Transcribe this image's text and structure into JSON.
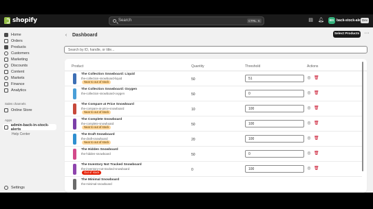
{
  "topbar": {
    "brand": "shopify",
    "search_placeholder": "Search",
    "shortcut_key_1": "CTRL",
    "shortcut_key_2": "K",
    "store_initials": "BS",
    "store_name": "back-stock-alert",
    "store_tag": "Dev"
  },
  "sidebar": {
    "items": [
      {
        "label": "Home",
        "icon": "home-icon"
      },
      {
        "label": "Orders",
        "icon": "orders-icon"
      },
      {
        "label": "Products",
        "icon": "products-icon"
      },
      {
        "label": "Customers",
        "icon": "customers-icon"
      },
      {
        "label": "Marketing",
        "icon": "marketing-icon"
      },
      {
        "label": "Discounts",
        "icon": "discounts-icon"
      },
      {
        "label": "Content",
        "icon": "content-icon"
      },
      {
        "label": "Markets",
        "icon": "markets-icon"
      },
      {
        "label": "Finance",
        "icon": "finance-icon"
      },
      {
        "label": "Analytics",
        "icon": "analytics-icon"
      }
    ],
    "sales_channels_label": "Sales channels",
    "online_store_label": "Online Store",
    "apps_label": "Apps",
    "app_name": "admin-back-in-stock-alerts",
    "help_center_label": "Help Center",
    "settings_label": "Settings"
  },
  "page": {
    "title": "Dashboard",
    "primary_button": "Select Products",
    "filter_placeholder": "Search by ID, handle, or title..."
  },
  "table": {
    "headers": {
      "product": "Product",
      "quantity": "Quantity",
      "threshold": "Threshold",
      "actions": "Actions"
    },
    "rows": [
      {
        "title": "The Collection Snowboard: Liquid",
        "handle": "the-collection-snowboard-liquid",
        "badge": "Near to out of stock",
        "badge_type": "warn",
        "quantity": "50",
        "threshold": "51",
        "thumb_color": "#3d6fb5"
      },
      {
        "title": "The Collection Snowboard: Oxygen",
        "handle": "the-collection-snowboard-oxygen",
        "badge": "",
        "badge_type": "",
        "quantity": "50",
        "threshold": "0",
        "thumb_color": "#4a9fd8"
      },
      {
        "title": "The Compare at Price Snowboard",
        "handle": "the-compare-at-price-snowboard",
        "badge": "Near to out of stock",
        "badge_type": "warn",
        "quantity": "10",
        "threshold": "100",
        "thumb_color": "#c7483a"
      },
      {
        "title": "The Complete Snowboard",
        "handle": "the-complete-snowboard",
        "badge": "Near to out of stock",
        "badge_type": "warn",
        "quantity": "50",
        "threshold": "100",
        "thumb_color": "#7b3fa8"
      },
      {
        "title": "The Draft Snowboard",
        "handle": "the-draft-snowboard",
        "badge": "Near to out of stock",
        "badge_type": "warn",
        "quantity": "20",
        "threshold": "100",
        "thumb_color": "#2f8fd0"
      },
      {
        "title": "The Hidden Snowboard",
        "handle": "the-hidden-snowboard",
        "badge": "",
        "badge_type": "",
        "quantity": "50",
        "threshold": "0",
        "thumb_color": "#d24a8a"
      },
      {
        "title": "The Inventory Not Tracked Snowboard",
        "handle": "the-inventory-not-tracked-snowboard",
        "badge": "Out of stock",
        "badge_type": "crit",
        "quantity": "0",
        "threshold": "100",
        "thumb_color": "#8e44ad"
      },
      {
        "title": "The Minimal Snowboard",
        "handle": "the-minimal-snowboard",
        "badge": "",
        "badge_type": "",
        "quantity": "",
        "threshold": "",
        "thumb_color": "#6b6b6b"
      }
    ]
  }
}
